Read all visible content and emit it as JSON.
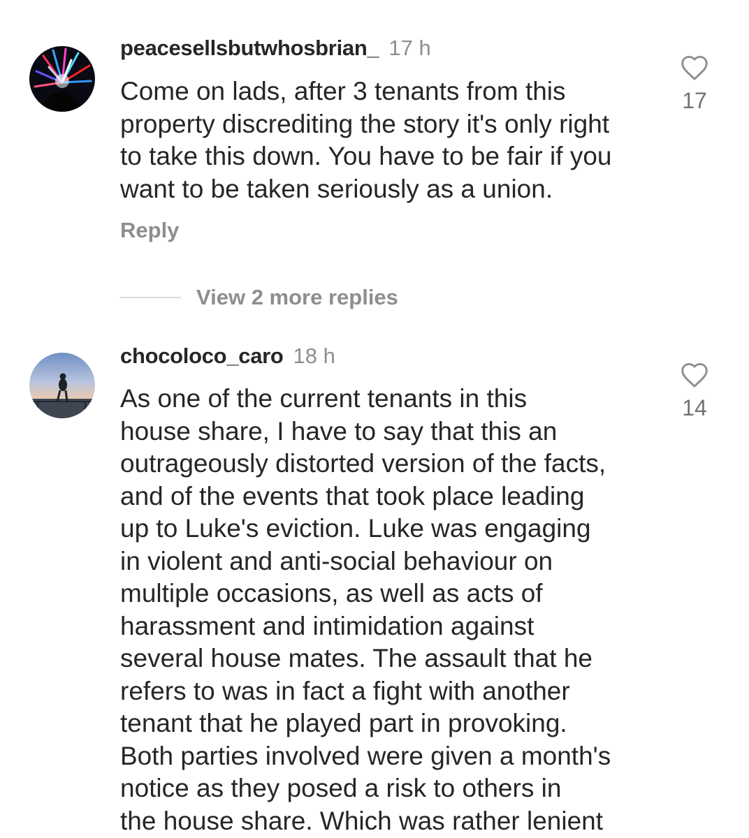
{
  "comments": [
    {
      "username": "peacesellsbutwhosbrian_",
      "timestamp": "17 h",
      "text_lines": [
        "Come on lads, after 3 tenants from this",
        "property discrediting the story it's only right",
        "to take this down. You have to be fair if you",
        "want to be taken seriously as a union."
      ],
      "like_count": "17",
      "reply_label": "Reply",
      "view_replies_label": "View 2 more replies"
    },
    {
      "username": "chocoloco_caro",
      "timestamp": "18 h",
      "text_lines": [
        "As one of the current tenants in this",
        "house share, I have to say that this an",
        "outrageously distorted version of the facts,",
        "and of the events that took place leading",
        "up to Luke's eviction. Luke was engaging",
        "in violent and anti-social behaviour on",
        "multiple occasions, as well as acts of",
        "harassment and intimidation against",
        "several house mates. The assault that he",
        "refers to was in fact a fight with another",
        "tenant that he played part in provoking.",
        "Both parties involved were given a month's",
        "notice as they posed a risk to others in",
        "the house share. Which was rather lenient"
      ],
      "like_count": "14"
    }
  ],
  "icons": {
    "like": "heart-outline-icon"
  },
  "colors": {
    "primary_text": "#262626",
    "secondary_text": "#8e8e8e",
    "divider": "#dbdbdb"
  }
}
